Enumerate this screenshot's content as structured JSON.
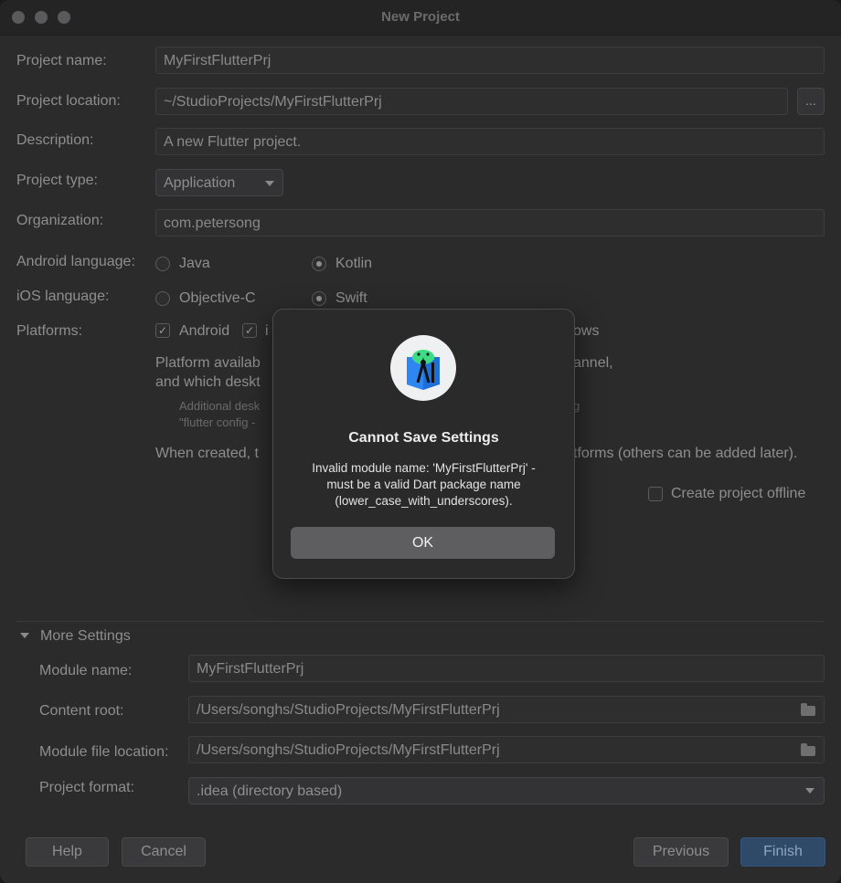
{
  "window": {
    "title": "New Project"
  },
  "form": {
    "project_name": {
      "label": "Project name:",
      "value": "MyFirstFlutterPrj"
    },
    "project_location": {
      "label": "Project location:",
      "value": "~/StudioProjects/MyFirstFlutterPrj",
      "browse": "..."
    },
    "description": {
      "label": "Description:",
      "value": "A new Flutter project."
    },
    "project_type": {
      "label": "Project type:",
      "value": "Application"
    },
    "organization": {
      "label": "Organization:",
      "value": "com.petersong"
    },
    "android_language": {
      "label": "Android language:",
      "options": [
        "Java",
        "Kotlin"
      ],
      "selected": "Kotlin"
    },
    "ios_language": {
      "label": "iOS language:",
      "options": [
        "Objective-C",
        "Swift"
      ],
      "selected": "Swift"
    },
    "platforms": {
      "label": "Platforms:",
      "android": "Android",
      "android_checked": true,
      "ios_partial": "i",
      "windows_partial": "ows"
    },
    "platform_text_line1_left": "Platform availab",
    "platform_text_line1_right": "annel,",
    "platform_text_line2_left": "and which deskt",
    "small_line1_left": "Additional desk",
    "small_line1_right": "g",
    "small_line2_left": "\"flutter config -",
    "when_created_left": "When created, t",
    "when_created_right": "tforms (others can be added later).",
    "create_offline": "Create project offline"
  },
  "more_settings": {
    "label": "More Settings",
    "module_name": {
      "label": "Module name:",
      "value": "MyFirstFlutterPrj"
    },
    "content_root": {
      "label": "Content root:",
      "value": "/Users/songhs/StudioProjects/MyFirstFlutterPrj"
    },
    "module_file_location": {
      "label": "Module file location:",
      "value": "/Users/songhs/StudioProjects/MyFirstFlutterPrj"
    },
    "project_format": {
      "label": "Project format:",
      "value": ".idea (directory based)"
    }
  },
  "buttons": {
    "help": "Help",
    "cancel": "Cancel",
    "previous": "Previous",
    "finish": "Finish"
  },
  "dialog": {
    "title": "Cannot Save Settings",
    "line1": "Invalid module name: 'MyFirstFlutterPrj' -",
    "line2": "must be a valid Dart package name",
    "line3": "(lower_case_with_underscores).",
    "ok": "OK"
  }
}
